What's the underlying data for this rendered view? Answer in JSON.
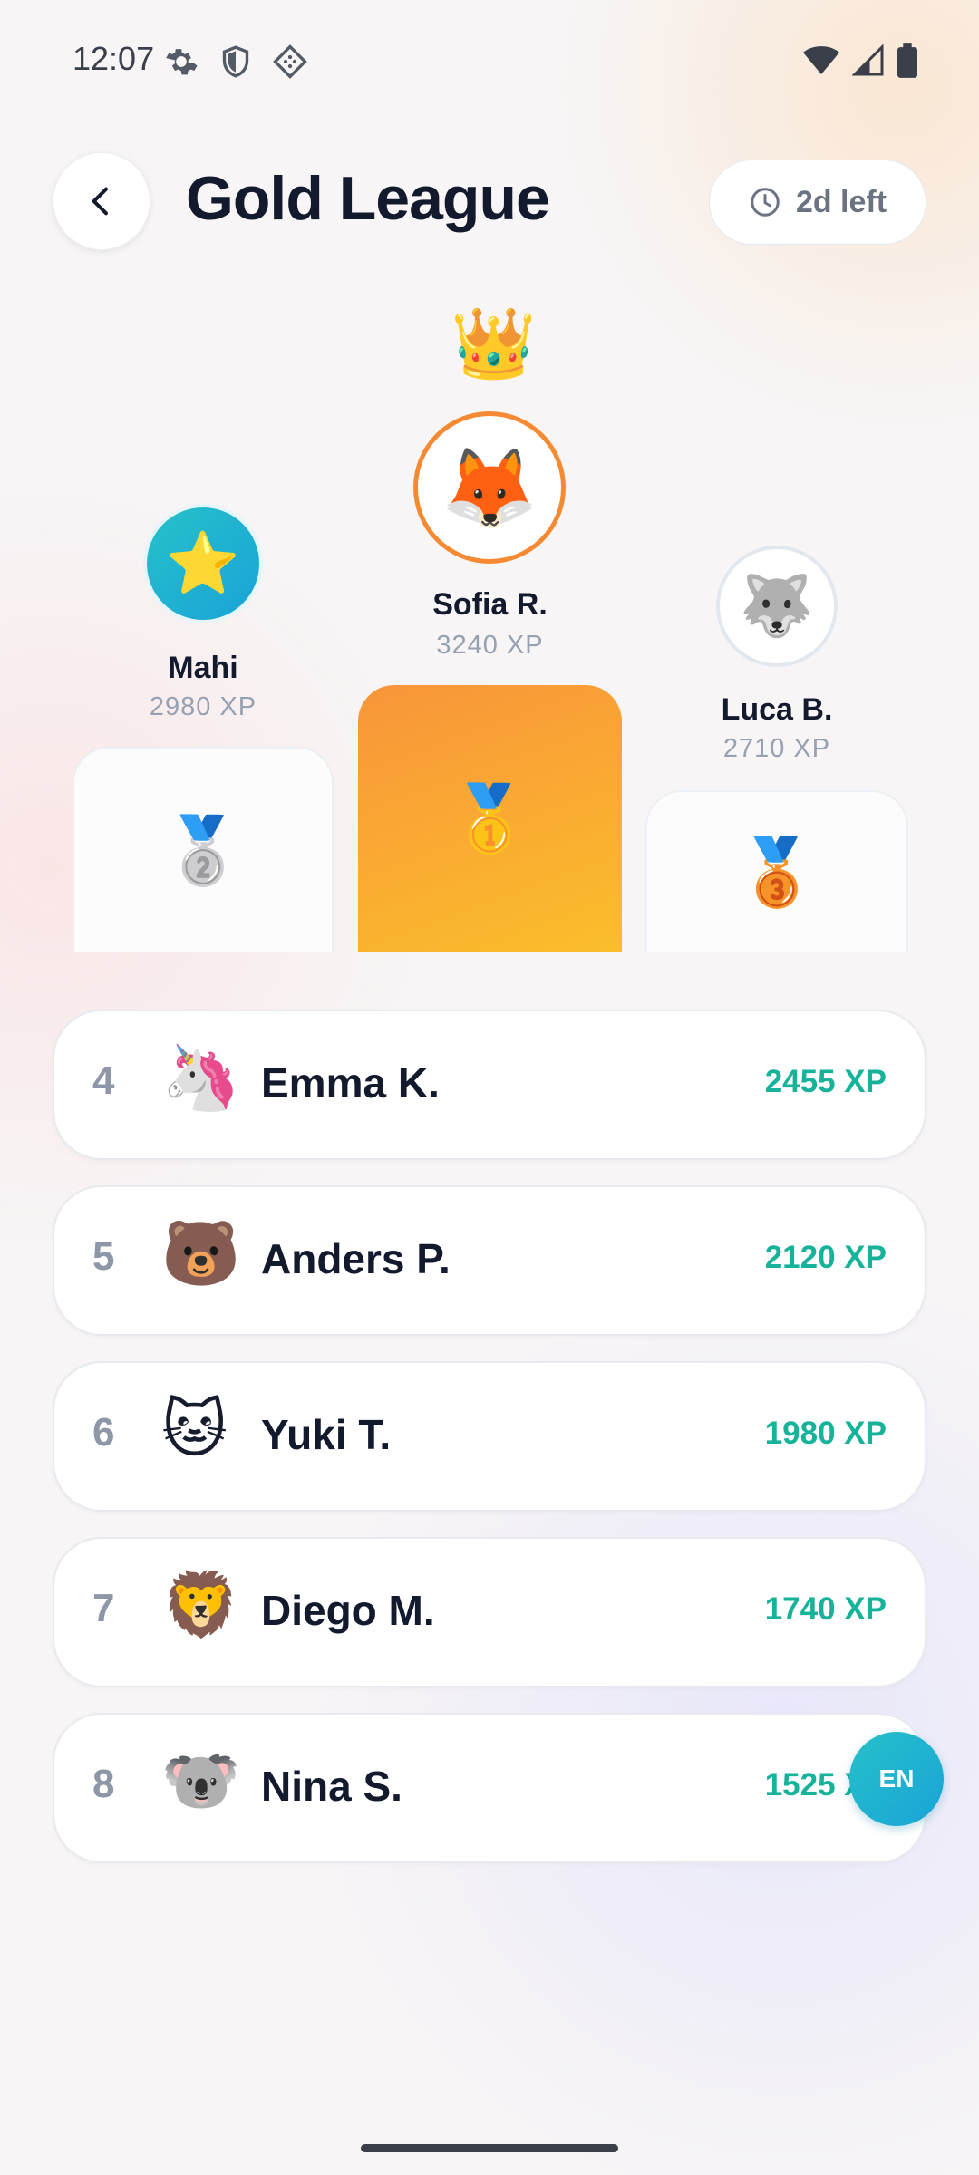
{
  "status_bar": {
    "time": "12:07",
    "left_icons": [
      "settings-icon",
      "shield-icon",
      "diamond-dots-icon"
    ],
    "right_icons": [
      "wifi-icon",
      "signal-icon",
      "battery-icon"
    ]
  },
  "header": {
    "back_icon": "chevron-left-icon",
    "title": "Gold League",
    "time_left": "2d left",
    "time_icon": "clock-icon"
  },
  "podium": {
    "crown": "👑",
    "first": {
      "name": "Sofia R.",
      "xp": "3240 XP",
      "avatar": "🦊",
      "medal": "🥇"
    },
    "second": {
      "name": "Mahi",
      "xp": "2980 XP",
      "avatar": "⭐",
      "medal": "🥈"
    },
    "third": {
      "name": "Luca B.",
      "xp": "2710 XP",
      "avatar": "🐺",
      "medal": "🥉"
    }
  },
  "rankings": [
    {
      "rank": "4",
      "avatar": "🦄",
      "name": "Emma K.",
      "xp": "2455 XP"
    },
    {
      "rank": "5",
      "avatar": "🐻",
      "name": "Anders P.",
      "xp": "2120 XP"
    },
    {
      "rank": "6",
      "avatar": "🐱",
      "name": "Yuki T.",
      "xp": "1980 XP"
    },
    {
      "rank": "7",
      "avatar": "🦁",
      "name": "Diego M.",
      "xp": "1740 XP"
    },
    {
      "rank": "8",
      "avatar": "🐨",
      "name": "Nina S.",
      "xp": "1525 XP"
    }
  ],
  "language_button": "EN",
  "colors": {
    "accent_orange": "#f58a32",
    "xp_teal": "#16b39a",
    "title": "#141a2e"
  }
}
